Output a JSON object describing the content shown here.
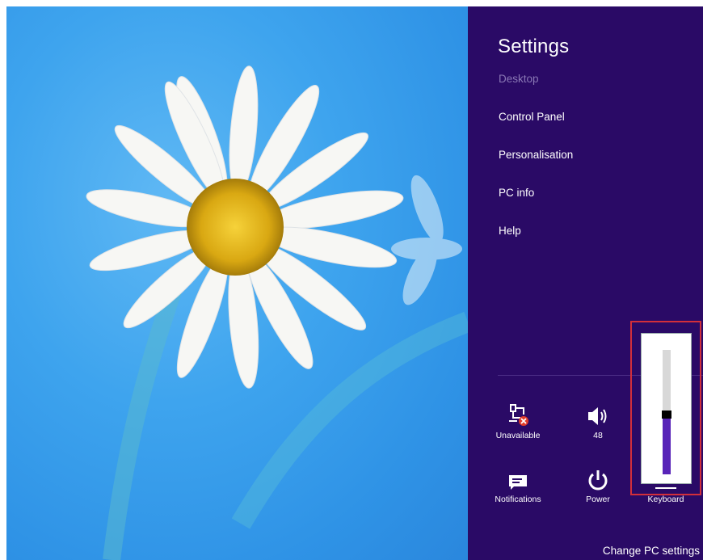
{
  "charm": {
    "title": "Settings",
    "items": [
      {
        "label": "Desktop",
        "state": "dimmed"
      },
      {
        "label": "Control Panel"
      },
      {
        "label": "Personalisation"
      },
      {
        "label": "PC info"
      },
      {
        "label": "Help"
      }
    ],
    "tiles": {
      "network": {
        "label": "Unavailable",
        "icon": "network-unavailable-icon"
      },
      "volume": {
        "label": "48",
        "icon": "speaker-icon"
      },
      "notifications": {
        "label": "Notifications",
        "icon": "notifications-icon"
      },
      "power": {
        "label": "Power",
        "icon": "power-icon"
      },
      "keyboard": {
        "label": "Keyboard",
        "icon": "keyboard-icon"
      }
    },
    "volume_slider": {
      "value": 48,
      "max": 100,
      "fill_color": "#5824b8"
    },
    "footer_link": "Change PC settings"
  },
  "colors": {
    "charm_bg": "#2a0a66",
    "highlight_border": "#d22f3a"
  }
}
